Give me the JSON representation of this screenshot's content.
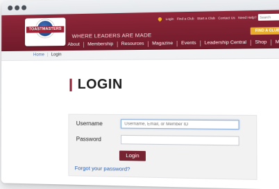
{
  "header": {
    "logo_text": "TOASTMASTERS",
    "logo_subtext": "INTERNATIONAL",
    "tagline": "WHERE LEADERS ARE MADE",
    "utility_links": [
      "Login",
      "Find a Club",
      "Start a Club",
      "Contact Us",
      "Need Help?"
    ],
    "search_placeholder": "Search",
    "find_club_label": "FIND A CLUB"
  },
  "nav": {
    "items": [
      "About",
      "Membership",
      "Resources",
      "Magazine",
      "Events",
      "Leadership Central",
      "Shop",
      "My Toastmasters"
    ]
  },
  "breadcrumb": {
    "home": "Home",
    "current": "Login"
  },
  "login": {
    "title": "LOGIN",
    "username_label": "Username",
    "username_placeholder": "Username, Email, or Member ID",
    "password_label": "Password",
    "password_placeholder": "",
    "submit_label": "Login",
    "forgot_label": "Forgot your password?"
  },
  "colors": {
    "brand": "#772432",
    "accent": "#e8ae2b",
    "link": "#2f5fa8"
  }
}
